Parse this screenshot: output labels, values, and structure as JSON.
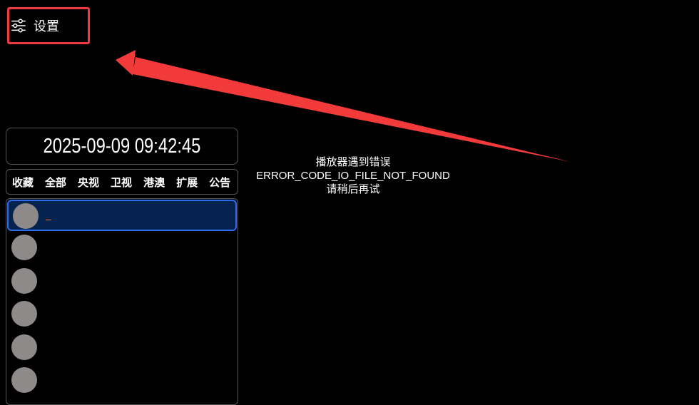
{
  "settings": {
    "label": "设置",
    "icon": "sliders-icon",
    "highlight_color": "#f23a3a"
  },
  "clock": {
    "datetime": "2025-09-09 09:42:45"
  },
  "tabs": [
    {
      "label": "收藏"
    },
    {
      "label": "全部"
    },
    {
      "label": "央视"
    },
    {
      "label": "卫视"
    },
    {
      "label": "港澳"
    },
    {
      "label": "扩展"
    },
    {
      "label": "公告"
    }
  ],
  "channels": [
    {
      "name": "_",
      "selected": true
    },
    {
      "name": "",
      "selected": false
    },
    {
      "name": "",
      "selected": false
    },
    {
      "name": "",
      "selected": false
    },
    {
      "name": "",
      "selected": false
    },
    {
      "name": "",
      "selected": false
    }
  ],
  "error": {
    "title": "播放器遇到错误",
    "code": "ERROR_CODE_IO_FILE_NOT_FOUND",
    "hint": "请稍后再试"
  },
  "colors": {
    "background": "#000000",
    "selected_bg": "#06224e",
    "selected_border": "#2b6cf2",
    "annotation": "#f23a3a",
    "logo_placeholder": "#8f8a8a"
  }
}
